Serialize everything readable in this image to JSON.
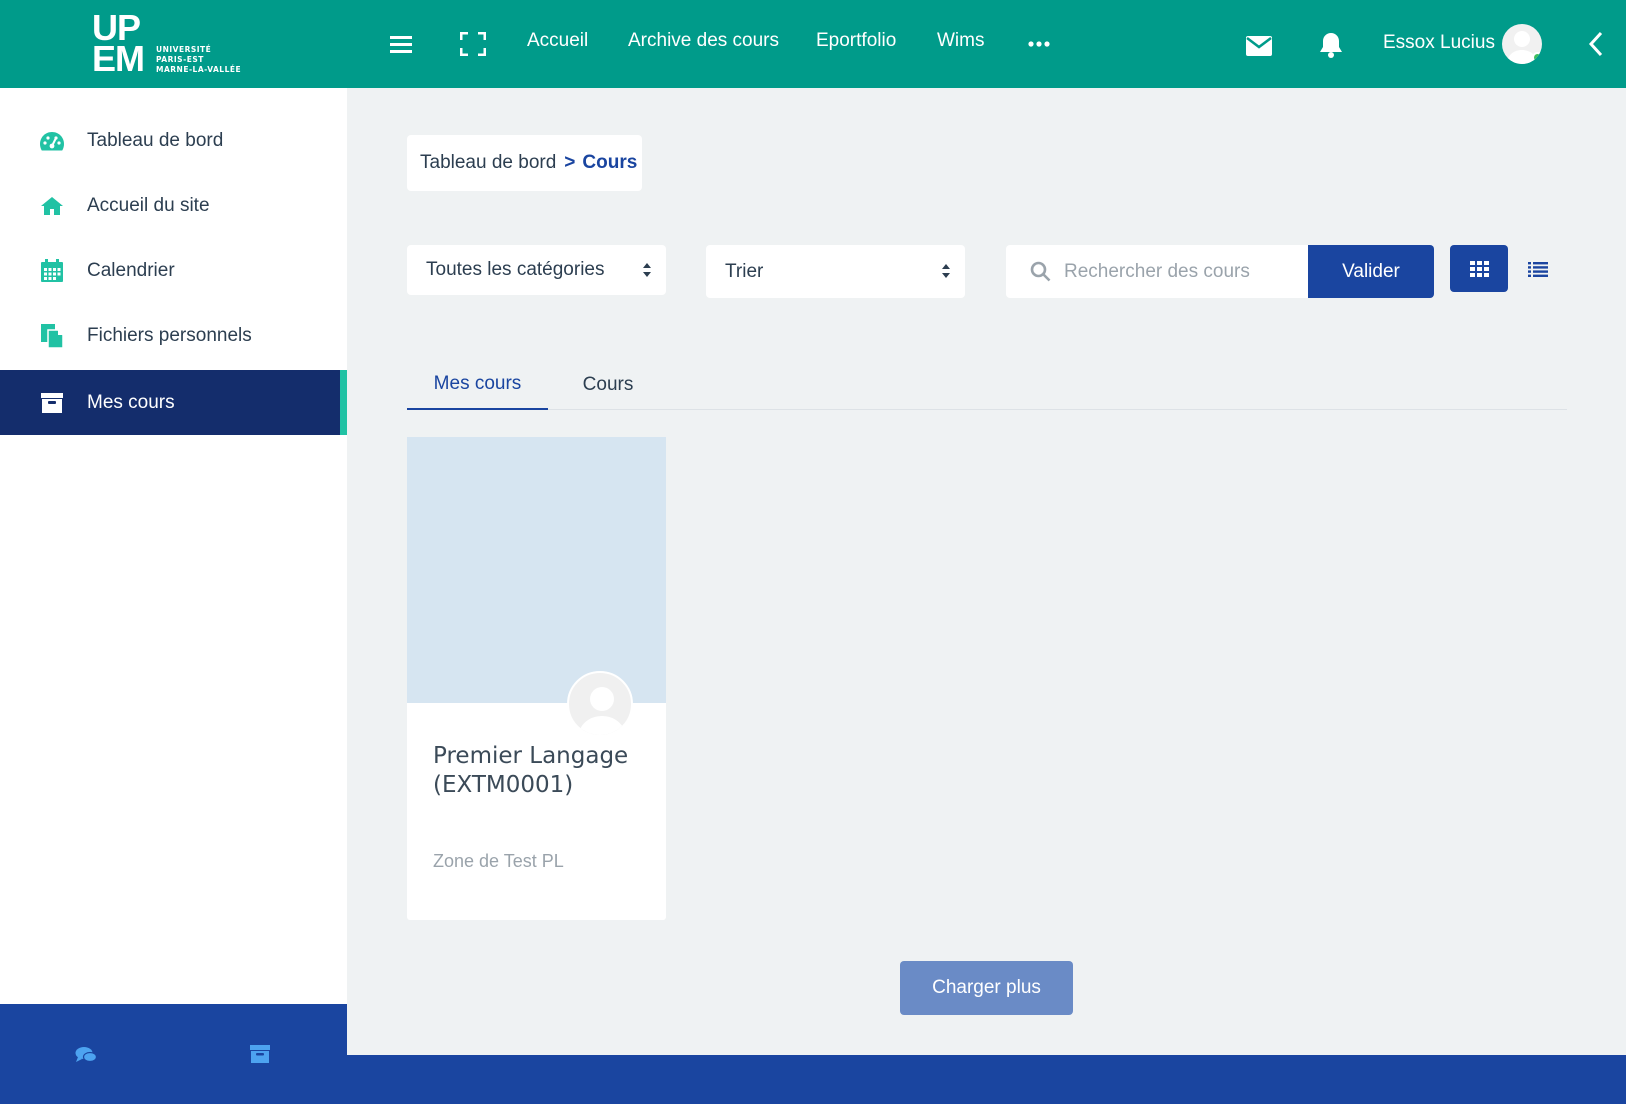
{
  "logo": {
    "big": "UP\nEM",
    "small_lines": [
      "UNIVERSITÉ",
      "PARIS-EST",
      "MARNE-LA-VALLÉE"
    ]
  },
  "topbar": {
    "icons": [
      "hamburger-menu-icon",
      "fullscreen-icon",
      "more-dots-icon",
      "mail-icon",
      "bell-icon",
      "chevron-left-icon"
    ],
    "nav": [
      "Accueil",
      "Archive des cours",
      "Eportfolio",
      "Wims"
    ],
    "username": "Essox Lucius",
    "online_status_color": "#3fbf5f"
  },
  "sidebar": {
    "items": [
      {
        "label": "Tableau de bord",
        "icon": "dashboard-gauge-icon",
        "active": false
      },
      {
        "label": "Accueil du site",
        "icon": "home-icon",
        "active": false
      },
      {
        "label": "Calendrier",
        "icon": "calendar-icon",
        "active": false
      },
      {
        "label": "Fichiers personnels",
        "icon": "files-icon",
        "active": false
      },
      {
        "label": "Mes cours",
        "icon": "archive-box-icon",
        "active": true
      }
    ],
    "footer_icons": [
      "chat-bubbles-icon",
      "archive-box-icon"
    ]
  },
  "breadcrumb": {
    "root": "Tableau de bord",
    "separator": ">",
    "current": "Cours"
  },
  "filters": {
    "category_select": "Toutes les catégories",
    "sort_select": "Trier",
    "search_placeholder": "Rechercher des cours",
    "submit_label": "Valider",
    "view_modes": [
      "grid-view-icon",
      "list-view-icon"
    ]
  },
  "tabs": [
    {
      "label": "Mes cours",
      "active": true
    },
    {
      "label": "Cours",
      "active": false
    }
  ],
  "courses": [
    {
      "title": "Premier Langage (EXTM0001)",
      "category": "Zone de Test PL"
    }
  ],
  "load_more_label": "Charger plus",
  "colors": {
    "topbar": "#009b8a",
    "accent_teal": "#21c2a4",
    "primary_blue": "#1a45a0",
    "sidebar_active": "#142d6c",
    "load_more": "#6a8bc6",
    "card_image": "#d6e5f1"
  }
}
